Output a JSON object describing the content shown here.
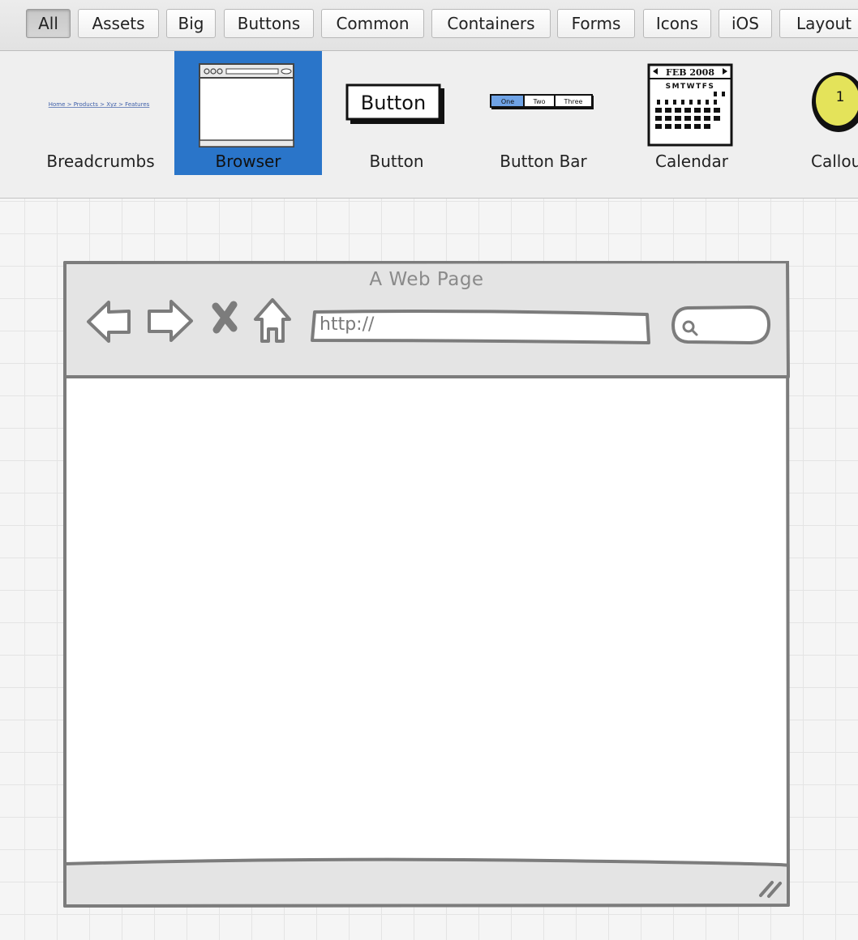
{
  "tabs": [
    {
      "label": "All",
      "active": true
    },
    {
      "label": "Assets",
      "active": false
    },
    {
      "label": "Big",
      "active": false
    },
    {
      "label": "Buttons",
      "active": false
    },
    {
      "label": "Common",
      "active": false
    },
    {
      "label": "Containers",
      "active": false
    },
    {
      "label": "Forms",
      "active": false
    },
    {
      "label": "Icons",
      "active": false
    },
    {
      "label": "iOS",
      "active": false
    },
    {
      "label": "Layout",
      "active": false
    }
  ],
  "gallery": {
    "selected": "Browser",
    "selected_color": "#2a75c9",
    "items": [
      {
        "label": "Breadcrumbs",
        "icon": "breadcrumbs-thumbnail",
        "thumb_text": "Home > Products > Xyz > Features"
      },
      {
        "label": "Browser",
        "icon": "browser-thumbnail"
      },
      {
        "label": "Button",
        "icon": "button-thumbnail",
        "thumb_text": "Button"
      },
      {
        "label": "Button Bar",
        "icon": "button-bar-thumbnail",
        "thumb_buttons": [
          "One",
          "Two",
          "Three"
        ]
      },
      {
        "label": "Calendar",
        "icon": "calendar-thumbnail",
        "thumb_header": "FEB 2008",
        "thumb_days": "SMTWTFS"
      },
      {
        "label": "Callou",
        "icon": "callout-thumbnail",
        "thumb_text": "1",
        "thumb_color": "#e4e35a"
      }
    ]
  },
  "mockup": {
    "title": "A Web Page",
    "url": "http://",
    "nav_icons": [
      "back-arrow-icon",
      "forward-arrow-icon",
      "stop-x-icon",
      "home-icon",
      "search-icon",
      "resize-grip-icon"
    ]
  }
}
